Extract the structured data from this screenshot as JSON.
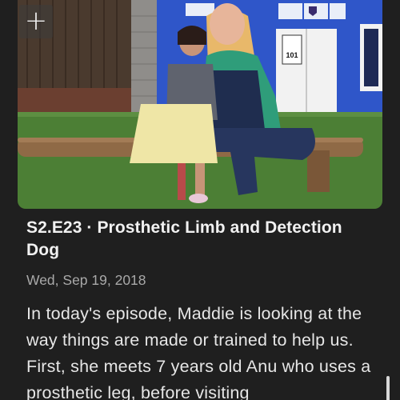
{
  "episode": {
    "title": "S2.E23 · Prosthetic Limb and Detection Dog",
    "date": "Wed, Sep 19, 2018",
    "description": "In today's episode, Maddie is looking at the way things are made or trained to help us. First, she meets 7 years old Anu who uses a prosthetic leg, before visiting"
  },
  "thumbnail": {
    "add_label": "+",
    "door_sign": "101"
  },
  "icons": {
    "add": "plus-icon"
  }
}
